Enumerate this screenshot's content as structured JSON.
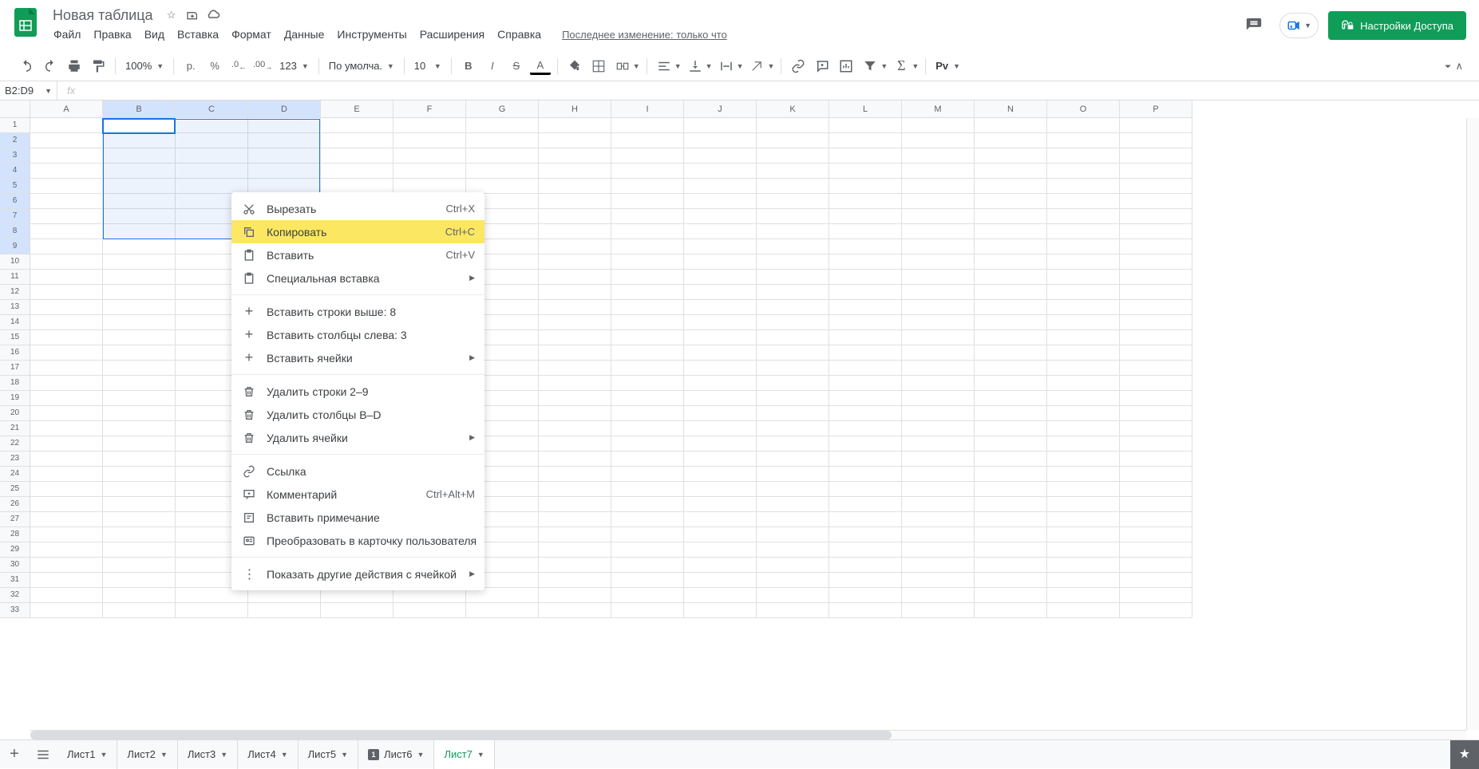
{
  "doc": {
    "title": "Новая таблица"
  },
  "menus": [
    "Файл",
    "Правка",
    "Вид",
    "Вставка",
    "Формат",
    "Данные",
    "Инструменты",
    "Расширения",
    "Справка"
  ],
  "last_edit": "Последнее изменение: только что",
  "share_label": "Настройки Доступа",
  "toolbar": {
    "zoom": "100%",
    "ruble": "р.",
    "percent": "%",
    "dec_minus": ".0",
    "dec_plus": ".00",
    "format_123": "123",
    "font": "По умолча...",
    "font_size": "10",
    "bold": "B",
    "italic": "I",
    "strike": "S",
    "color": "A",
    "pv": "Pv"
  },
  "name_box": "B2:D9",
  "columns": [
    "A",
    "B",
    "C",
    "D",
    "E",
    "F",
    "G",
    "H",
    "I",
    "J",
    "K",
    "L",
    "M",
    "N",
    "O",
    "P"
  ],
  "row_count": 33,
  "selected_cols": [
    1,
    2,
    3
  ],
  "selected_rows": [
    2,
    3,
    4,
    5,
    6,
    7,
    8,
    9
  ],
  "context_menu": {
    "groups": [
      [
        {
          "icon": "cut",
          "label": "Вырезать",
          "shortcut": "Ctrl+X",
          "arrow": false
        },
        {
          "icon": "copy",
          "label": "Копировать",
          "shortcut": "Ctrl+C",
          "arrow": false,
          "highlight": true
        },
        {
          "icon": "paste",
          "label": "Вставить",
          "shortcut": "Ctrl+V",
          "arrow": false
        },
        {
          "icon": "paste",
          "label": "Специальная вставка",
          "shortcut": "",
          "arrow": true
        }
      ],
      [
        {
          "icon": "plus",
          "label": "Вставить строки выше: 8",
          "shortcut": "",
          "arrow": false
        },
        {
          "icon": "plus",
          "label": "Вставить столбцы слева: 3",
          "shortcut": "",
          "arrow": false
        },
        {
          "icon": "plus",
          "label": "Вставить ячейки",
          "shortcut": "",
          "arrow": true
        }
      ],
      [
        {
          "icon": "trash",
          "label": "Удалить строки 2–9",
          "shortcut": "",
          "arrow": false
        },
        {
          "icon": "trash",
          "label": "Удалить столбцы B–D",
          "shortcut": "",
          "arrow": false
        },
        {
          "icon": "trash",
          "label": "Удалить ячейки",
          "shortcut": "",
          "arrow": true
        }
      ],
      [
        {
          "icon": "link",
          "label": "Ссылка",
          "shortcut": "",
          "arrow": false
        },
        {
          "icon": "comment",
          "label": "Комментарий",
          "shortcut": "Ctrl+Alt+M",
          "arrow": false
        },
        {
          "icon": "note",
          "label": "Вставить примечание",
          "shortcut": "",
          "arrow": false
        },
        {
          "icon": "card",
          "label": "Преобразовать в карточку пользователя",
          "shortcut": "",
          "arrow": false
        }
      ],
      [
        {
          "icon": "more",
          "label": "Показать другие действия с ячейкой",
          "shortcut": "",
          "arrow": true
        }
      ]
    ]
  },
  "sheets": [
    {
      "name": "Лист1",
      "active": false,
      "indicator": false
    },
    {
      "name": "Лист2",
      "active": false,
      "indicator": false
    },
    {
      "name": "Лист3",
      "active": false,
      "indicator": false
    },
    {
      "name": "Лист4",
      "active": false,
      "indicator": false
    },
    {
      "name": "Лист5",
      "active": false,
      "indicator": false
    },
    {
      "name": "Лист6",
      "active": false,
      "indicator": true
    },
    {
      "name": "Лист7",
      "active": true,
      "indicator": false
    }
  ]
}
